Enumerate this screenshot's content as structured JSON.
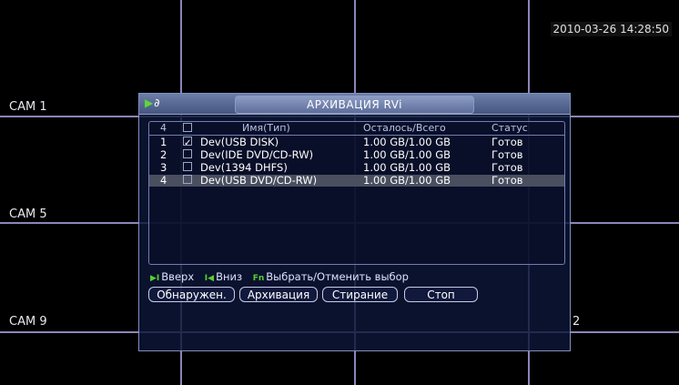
{
  "timestamp": "2010-03-26 14:28:50",
  "cams": {
    "c1": "CAM 1",
    "c5": "CAM 5",
    "c9": "CAM 9",
    "stray": "2"
  },
  "dialog": {
    "title": "АРХИВАЦИЯ RVi",
    "list": {
      "header": {
        "count": "4",
        "name": "Имя(Тип)",
        "size": "Осталось/Всего",
        "status": "Статус"
      },
      "rows": [
        {
          "num": "1",
          "checked": "✓",
          "name": "Dev(USB DISK)",
          "size": "1.00 GB/1.00 GB",
          "status": "Готов"
        },
        {
          "num": "2",
          "checked": "",
          "name": "Dev(IDE DVD/CD-RW)",
          "size": "1.00 GB/1.00 GB",
          "status": "Готов"
        },
        {
          "num": "3",
          "checked": "",
          "name": "Dev(1394 DHFS)",
          "size": "1.00 GB/1.00 GB",
          "status": "Готов"
        },
        {
          "num": "4",
          "checked": "",
          "name": "Dev(USB DVD/CD-RW)",
          "size": "1.00 GB/1.00 GB",
          "status": "Готов"
        }
      ]
    },
    "hints": {
      "up_key": "▶I",
      "up": "Вверх",
      "down_key": "I◀",
      "down": "Вниз",
      "fn_key": "Fn",
      "fn": "Выбрать/Отменить выбор"
    },
    "buttons": {
      "detect": "Обнаружен.",
      "backup": "Архивация",
      "erase": "Стирание",
      "stop": "Стоп"
    }
  }
}
